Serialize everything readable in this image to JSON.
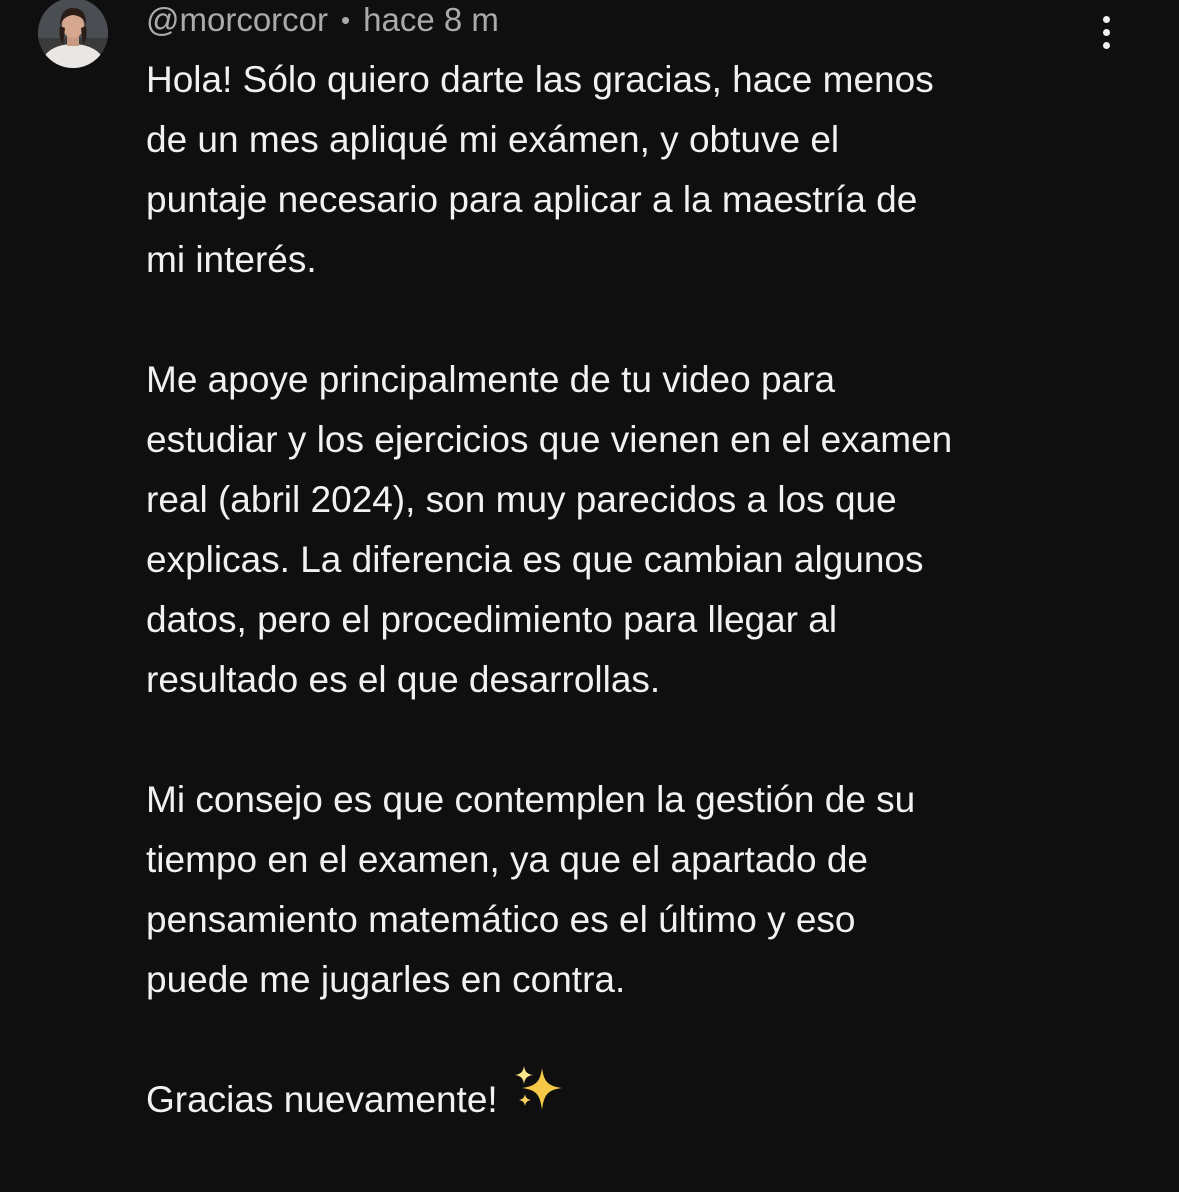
{
  "comment": {
    "author": "@morcorcor",
    "separator": "•",
    "time": "hace 8 m",
    "menu_icon": "more-vert-icon",
    "avatar_icon": "avatar-photo",
    "paragraphs": [
      {
        "lines": [
          "Hola! Sólo quiero darte las gracias, hace menos",
          "de un mes apliqué mi exámen, y obtuve el",
          "puntaje necesario para aplicar a la maestría de",
          "mi interés."
        ]
      },
      {
        "lines": [
          "Me apoye principalmente de tu video para",
          "estudiar y los ejercicios que vienen en el examen",
          "real (abril 2024), son muy parecidos a los que",
          "explicas. La diferencia es que cambian algunos",
          "datos, pero el procedimiento para llegar al",
          "resultado es el que desarrollas."
        ]
      },
      {
        "lines": [
          "Mi consejo es que contemplen la gestión de su",
          "tiempo en el examen, ya que el apartado de",
          "pensamiento matemático es el último y eso",
          "puede me jugarles en contra."
        ]
      },
      {
        "lines": [
          "Gracias nuevamente!"
        ]
      }
    ],
    "sparkle_icon": "sparkles-emoji-icon",
    "colors": {
      "background": "#0f0f0f",
      "text": "#f1f1f1",
      "meta": "#aaaaaa",
      "sparkle": "#f5c542"
    }
  }
}
